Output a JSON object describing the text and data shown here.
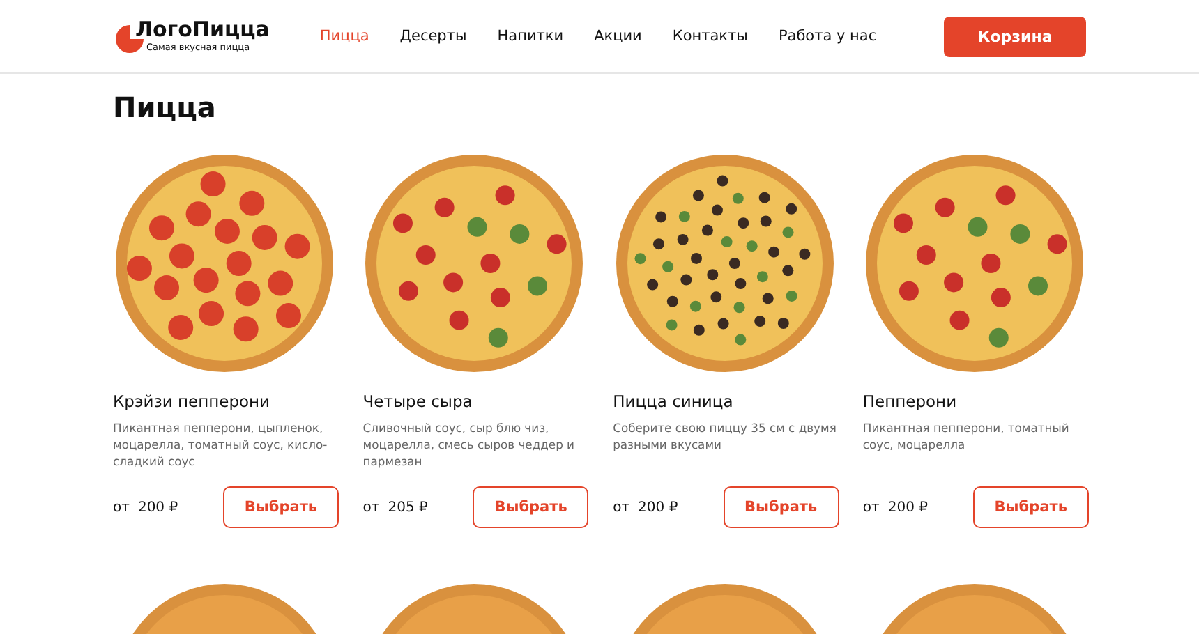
{
  "header": {
    "logo": {
      "name": "ЛогоПицца",
      "tagline": "Самая вкусная пицца"
    },
    "nav": [
      {
        "label": "Пицца",
        "selected": true
      },
      {
        "label": "Десерты",
        "selected": false
      },
      {
        "label": "Напитки",
        "selected": false
      },
      {
        "label": "Акции",
        "selected": false
      },
      {
        "label": "Контакты",
        "selected": false
      },
      {
        "label": "Работа у нас",
        "selected": false
      }
    ],
    "cart_button": "Корзина"
  },
  "section_title": "Пицца",
  "products": [
    {
      "name": "Крэйзи пепперони",
      "description": "Пикантная пепперони, цыпленок, моцарелла, томатный соус, кисло-сладкий соус",
      "price_prefix": "от",
      "price": "200 ₽",
      "button": "Выбрать",
      "kind": "pepperoni"
    },
    {
      "name": "Четыре сыра",
      "description": "Сливочный соус, сыр блю чиз, моцарелла, смесь сыров чеддер и пармезан",
      "price_prefix": "от",
      "price": "205 ₽",
      "button": "Выбрать",
      "kind": "mixed"
    },
    {
      "name": "Пицца синица",
      "description": "Соберите свою пиццу 35 см с двумя разными вкусами",
      "price_prefix": "от",
      "price": "200 ₽",
      "button": "Выбрать",
      "kind": "veggie"
    },
    {
      "name": "Пепперони",
      "description": "Пикантная пепперони, томатный соус, моцарелла",
      "price_prefix": "от",
      "price": "200 ₽",
      "button": "Выбрать",
      "kind": "mixed"
    }
  ]
}
